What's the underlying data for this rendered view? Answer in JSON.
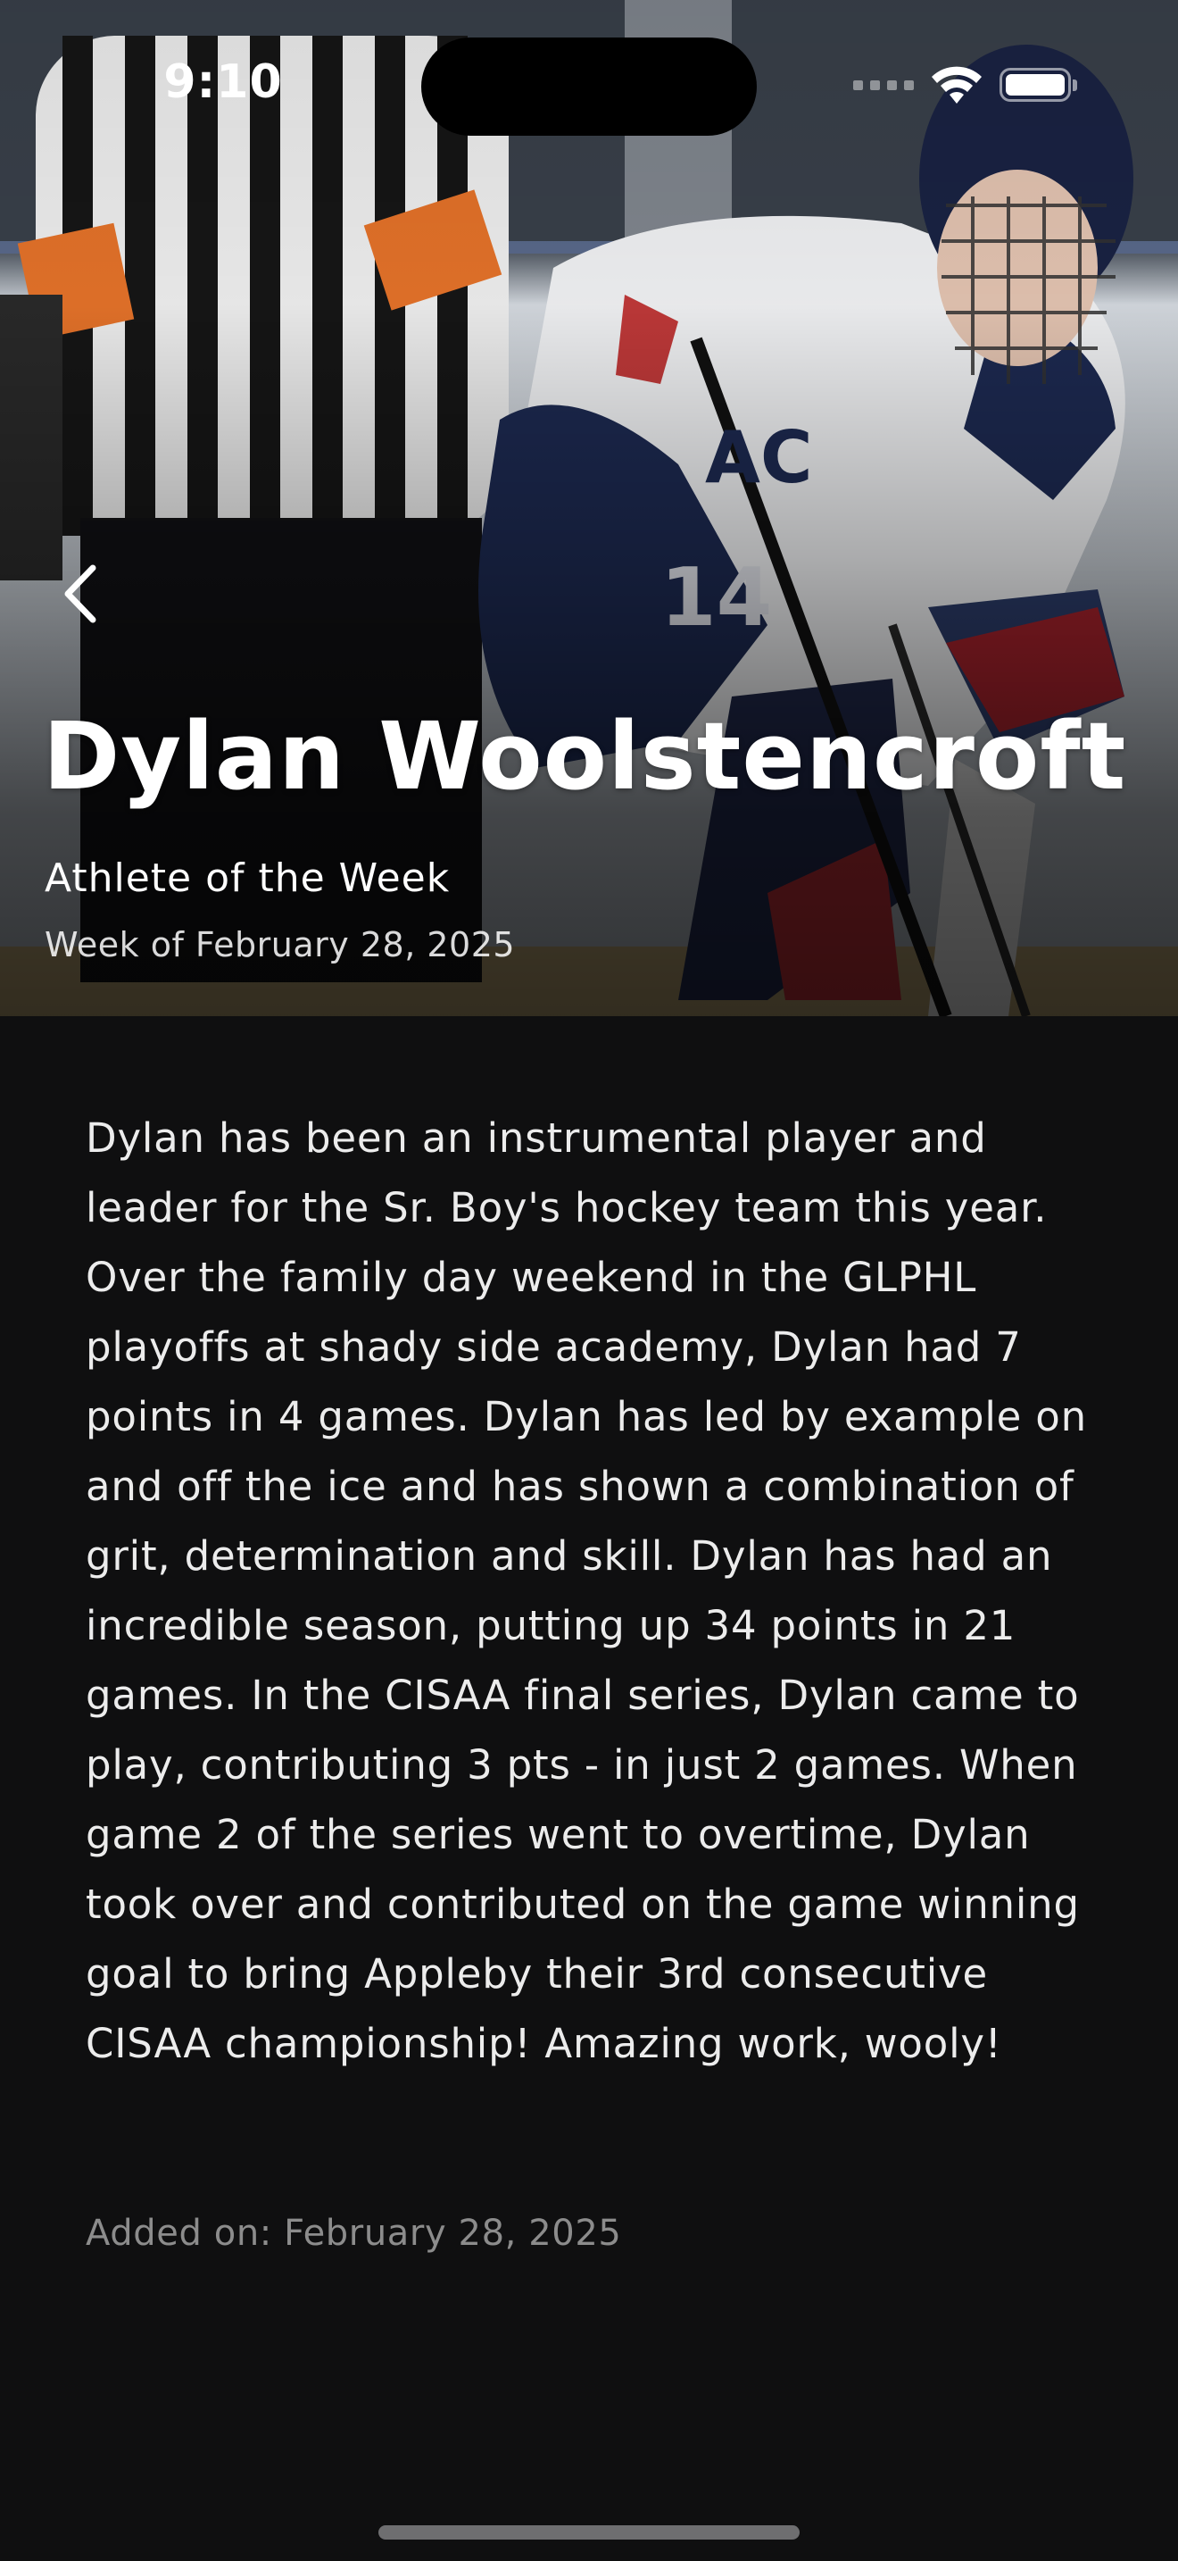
{
  "status_bar": {
    "time": "9:10",
    "signal_icon": "cellular-dots-icon",
    "wifi_icon": "wifi-icon",
    "battery_icon": "battery-icon",
    "battery_level": 1.0
  },
  "hero": {
    "image": "hockey-player-photo",
    "back_icon": "chevron-left-icon",
    "name": "Dylan Woolstencroft",
    "subtitle": "Athlete of the Week",
    "week_label": "Week of February 28, 2025"
  },
  "article": {
    "description": "Dylan has been an instrumental player and leader for the Sr. Boy's hockey team this year. Over the family day weekend in the GLPHL playoffs at shady side academy, Dylan had 7 points in 4 games. Dylan has led by example on and off the ice and has shown a combination of grit, determination and skill. Dylan has had an incredible season, putting up 34 points in 21 games. In the CISAA final series, Dylan came to play, contributing 3 pts - in just 2 games. When game 2 of the series went to overtime, Dylan took over and contributed on the game winning goal to bring Appleby their 3rd consecutive CISAA championship! Amazing work, wooly!",
    "added_on": "Added on: February 28, 2025"
  },
  "colors": {
    "background": "#0f0f10",
    "text_primary": "#ffffff",
    "text_body": "#ececec",
    "text_muted": "#8c8c8c"
  }
}
